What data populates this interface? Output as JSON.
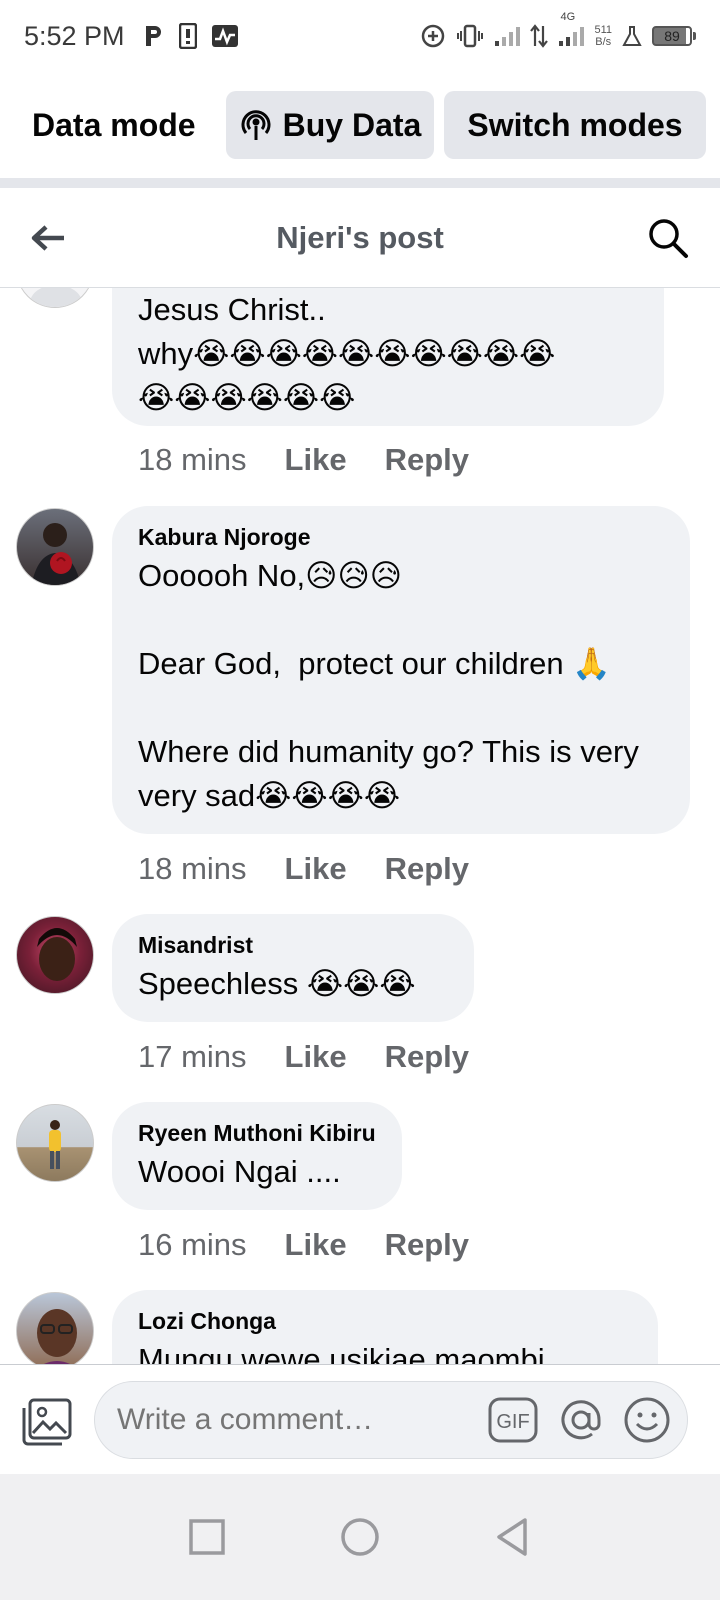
{
  "status_bar": {
    "time": "5:52 PM",
    "network": "4G",
    "speed_value": "511",
    "speed_unit": "B/s",
    "battery": "89"
  },
  "data_bar": {
    "mode_label": "Data mode",
    "buy_label": "Buy Data",
    "switch_label": "Switch modes"
  },
  "header": {
    "title": "Njeri's post"
  },
  "comments": [
    {
      "author": "",
      "text_line1": "Jesus Christ..",
      "text_line2": "why😭😭😭😭😭😭😭😭😭😭",
      "text_line3": "😭😭😭😭😭😭",
      "time": "18 mins",
      "like": "Like",
      "reply": "Reply"
    },
    {
      "author": "Kabura Njoroge",
      "text": "Oooooh No,😥😥😥\n\nDear God,  protect our children 🙏\n\nWhere did humanity go? This is very very sad😭😭😭😭",
      "time": "18 mins",
      "like": "Like",
      "reply": "Reply"
    },
    {
      "author": "Misandrist",
      "text": "Speechless 😭😭😭",
      "time": "17 mins",
      "like": "Like",
      "reply": "Reply"
    },
    {
      "author": "Ryeen Muthoni Kibiru",
      "text": "Woooi Ngai ....",
      "time": "16 mins",
      "like": "Like",
      "reply": "Reply"
    },
    {
      "author": "Lozi Chonga",
      "text": "Mungu wewe usikiae maombi",
      "time": "",
      "like": "",
      "reply": ""
    }
  ],
  "comment_input": {
    "placeholder": "Write a comment…",
    "gif_label": "GIF"
  },
  "icons": {
    "back": "back-arrow-icon",
    "search": "search-icon",
    "broadcast": "broadcast-icon",
    "photo": "photo-icon",
    "gif": "gif-icon",
    "mention": "mention-icon",
    "emoji": "emoji-icon",
    "nav_recents": "square-icon",
    "nav_home": "circle-icon",
    "nav_back": "triangle-icon"
  },
  "colors": {
    "bubble": "#f0f2f5",
    "chip": "#e4e6eb",
    "meta_text": "#65676b"
  }
}
